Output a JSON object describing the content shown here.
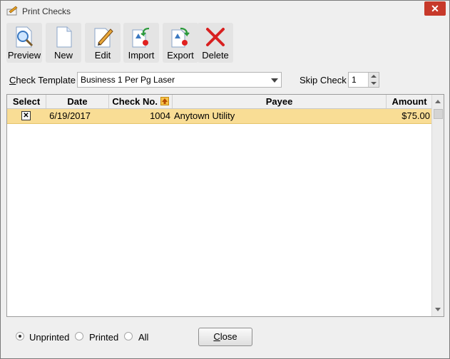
{
  "window": {
    "title": "Print Checks",
    "close_glyph": "✕"
  },
  "toolbar": [
    {
      "label": "Preview",
      "icon": "magnifier-page-icon"
    },
    {
      "label": "New",
      "icon": "blank-page-icon"
    },
    {
      "label": "Edit",
      "icon": "pencil-page-icon"
    },
    {
      "label": "Import",
      "icon": "import-page-icon"
    },
    {
      "label": "Export",
      "icon": "export-page-icon"
    },
    {
      "label": "Delete",
      "icon": "red-x-icon"
    }
  ],
  "template": {
    "label_rest": "heck Template",
    "label_mnemonic": "C",
    "value": "Business 1 Per Pg Laser"
  },
  "skip": {
    "label": "Skip Check",
    "value": "1"
  },
  "grid": {
    "columns": [
      "Select",
      "Date",
      "Check No.",
      "Payee",
      "Amount"
    ],
    "rows": [
      {
        "selected": true,
        "date": "6/19/2017",
        "check_no": "1004",
        "payee": "Anytown Utility",
        "amount": "$75.00"
      }
    ]
  },
  "filter": {
    "options": [
      "Unprinted",
      "Printed",
      "All"
    ],
    "selected": "Unprinted"
  },
  "close_button": {
    "label_mnemonic": "C",
    "label_rest": "lose"
  },
  "colors": {
    "selected_row": "#f9dd95",
    "close_red": "#c7392a"
  }
}
